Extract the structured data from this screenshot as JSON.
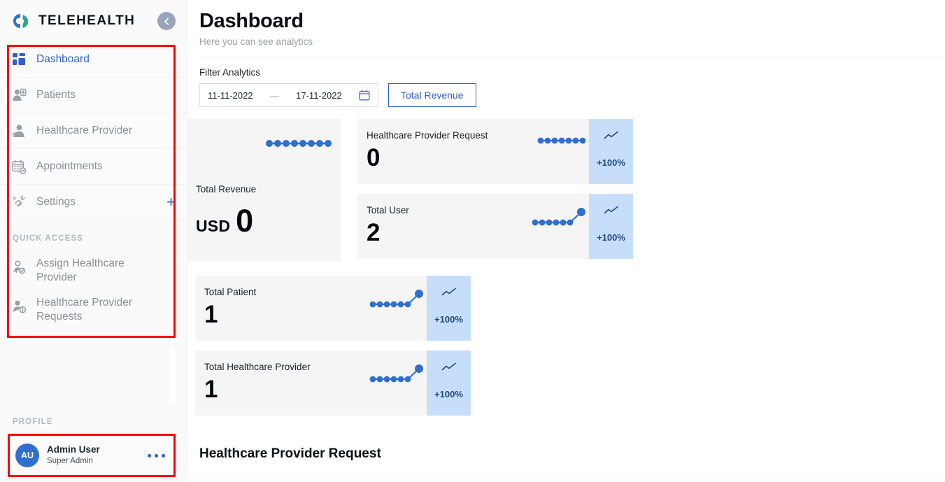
{
  "brand": {
    "name": "TELEHEALTH",
    "logo_icon": "telehealth-logo-icon",
    "collapse_icon": "chevron-left-icon"
  },
  "sidebar": {
    "nav_items": [
      {
        "label": "Dashboard",
        "icon": "dashboard-grid-icon",
        "active": true
      },
      {
        "label": "Patients",
        "icon": "patient-user-icon",
        "active": false
      },
      {
        "label": "Healthcare Provider",
        "icon": "doctor-user-icon",
        "active": false
      },
      {
        "label": "Appointments",
        "icon": "calendar-check-icon",
        "active": false
      },
      {
        "label": "Settings",
        "icon": "gears-icon",
        "active": false,
        "trailing": "+"
      }
    ],
    "quick_access_label": "QUICK ACCESS",
    "quick_items": [
      {
        "label": "Assign Healthcare Provider",
        "icon": "assign-provider-icon"
      },
      {
        "label": "Healthcare Provider Requests",
        "icon": "provider-request-icon"
      }
    ],
    "profile_label": "PROFILE",
    "profile": {
      "initials": "AU",
      "name": "Admin User",
      "role": "Super Admin",
      "menu_icon": "more-dots-icon"
    }
  },
  "header": {
    "title": "Dashboard",
    "subtitle": "Here you can see analytics"
  },
  "filter": {
    "label": "Filter Analytics",
    "start_date": "11-11-2022",
    "separator": "—",
    "end_date": "17-11-2022",
    "calendar_icon": "calendar-icon",
    "button_label": "Total Revenue"
  },
  "revenue_card": {
    "label": "Total Revenue",
    "currency": "USD",
    "value": "0",
    "spark_icon": "flat-sparkline-icon"
  },
  "stat_cards": [
    {
      "id": "hpr",
      "title": "Healthcare Provider Request",
      "value": "0",
      "percent": "+100%",
      "trend_icon": "trend-up-icon",
      "spark": "flat"
    },
    {
      "id": "user",
      "title": "Total User",
      "value": "2",
      "percent": "+100%",
      "trend_icon": "trend-up-icon",
      "spark": "rising"
    },
    {
      "id": "pat",
      "title": "Total Patient",
      "value": "1",
      "percent": "+100%",
      "trend_icon": "trend-up-icon",
      "spark": "rising"
    },
    {
      "id": "thp",
      "title": "Total Healthcare Provider",
      "value": "1",
      "percent": "+100%",
      "trend_icon": "trend-up-icon",
      "spark": "rising"
    }
  ],
  "bottom_section": {
    "title": "Healthcare Provider Request"
  },
  "colors": {
    "accent_blue": "#2f5fd0",
    "spark_blue": "#2f6fd0",
    "badge_bg": "#c7defb",
    "badge_text": "#23477f",
    "card_bg": "#f5f5f5",
    "sidebar_bg": "#fafafa",
    "muted_text": "#8a8f98",
    "annotation_red": "#fb0007"
  }
}
